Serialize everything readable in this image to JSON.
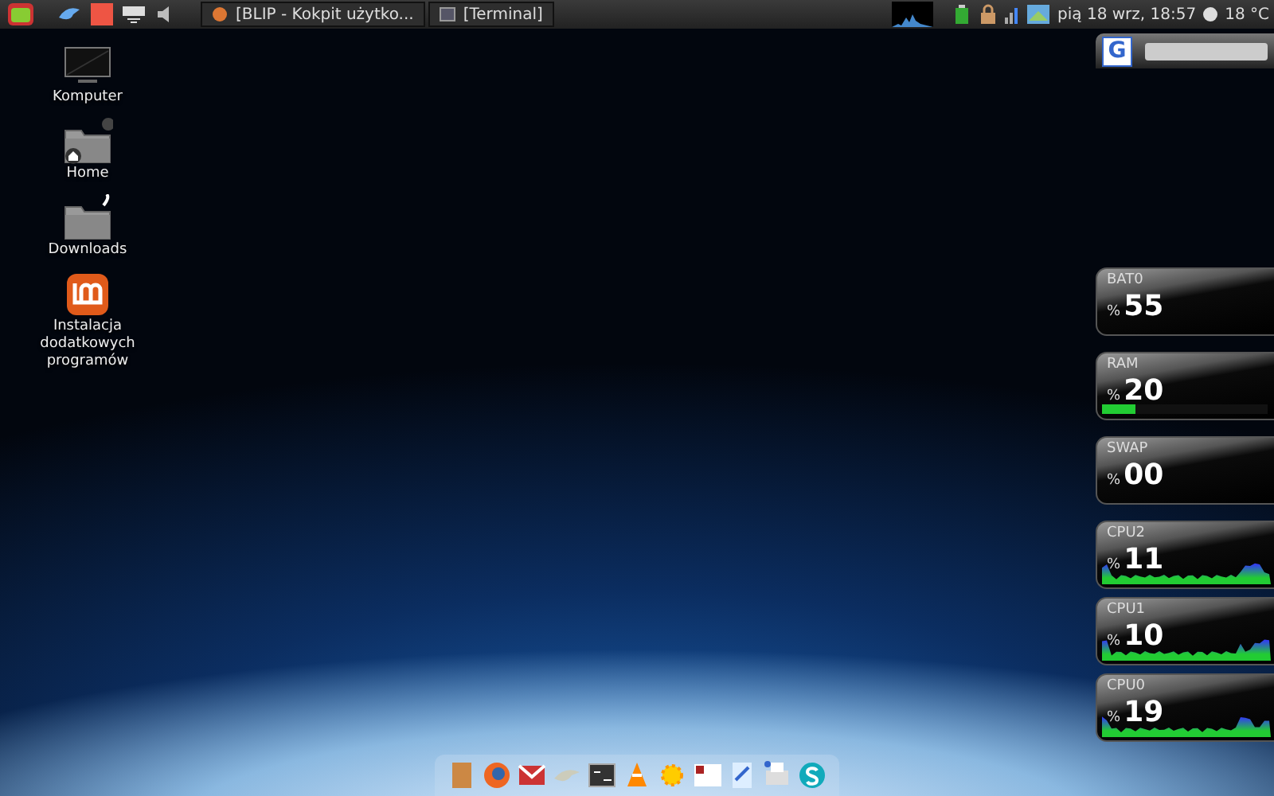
{
  "top_panel": {
    "windows": [
      {
        "title": "[BLIP - Kokpit użytko...",
        "selected": false
      },
      {
        "title": "[Terminal]",
        "selected": false
      }
    ],
    "clock": "pią 18 wrz, 18:57",
    "weather": "18 °C"
  },
  "desktop_icons": [
    {
      "label": "Komputer",
      "kind": "computer"
    },
    {
      "label": "Home",
      "kind": "home"
    },
    {
      "label": "Downloads",
      "kind": "downloads"
    },
    {
      "label": "Instalacja dodatkowych programów",
      "kind": "mint"
    }
  ],
  "search_widget": {
    "logo": "G"
  },
  "meters": [
    {
      "label": "BAT0",
      "unit": "%",
      "value": "55",
      "kind": "plain"
    },
    {
      "label": "RAM",
      "unit": "%",
      "value": "20",
      "kind": "bar",
      "level": 0.2
    },
    {
      "label": "SWAP",
      "unit": "%",
      "value": "00",
      "kind": "plain"
    },
    {
      "label": "CPU2",
      "unit": "%",
      "value": "11",
      "kind": "graph"
    },
    {
      "label": "CPU1",
      "unit": "%",
      "value": "10",
      "kind": "graph"
    },
    {
      "label": "CPU0",
      "unit": "%",
      "value": "19",
      "kind": "graph"
    }
  ]
}
